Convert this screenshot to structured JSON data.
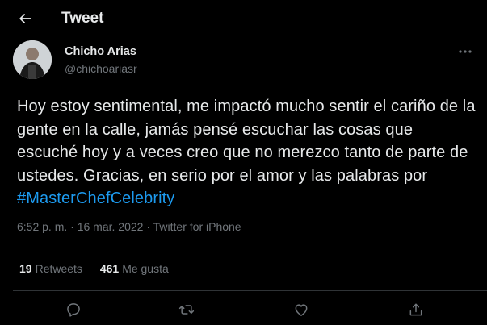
{
  "header": {
    "title": "Tweet",
    "back_icon": "arrow-left-icon"
  },
  "author": {
    "name": "Chicho Arias",
    "handle": "@chichoariasr"
  },
  "tweet": {
    "text": "Hoy estoy sentimental, me impactó mucho sentir el cariño de la gente en la calle, jamás pensé escuchar las cosas que escuché hoy y a veces creo que no merezco tanto de parte de ustedes. Gracias, en serio por el amor y las palabras por ",
    "hashtag": "#MasterChefCelebrity"
  },
  "meta": {
    "time": "6:52 p. m.",
    "separator": " · ",
    "date": "16 mar. 2022",
    "source": "Twitter for iPhone"
  },
  "stats": {
    "retweets_count": "19",
    "retweets_label": "Retweets",
    "likes_count": "461",
    "likes_label": "Me gusta"
  },
  "actions": {
    "reply_icon": "reply-icon",
    "retweet_icon": "retweet-icon",
    "like_icon": "heart-icon",
    "share_icon": "share-icon"
  },
  "colors": {
    "background": "#000000",
    "text": "#e7e9ea",
    "secondary": "#71767b",
    "accent": "#1d9bf0",
    "divider": "#2f3336"
  }
}
